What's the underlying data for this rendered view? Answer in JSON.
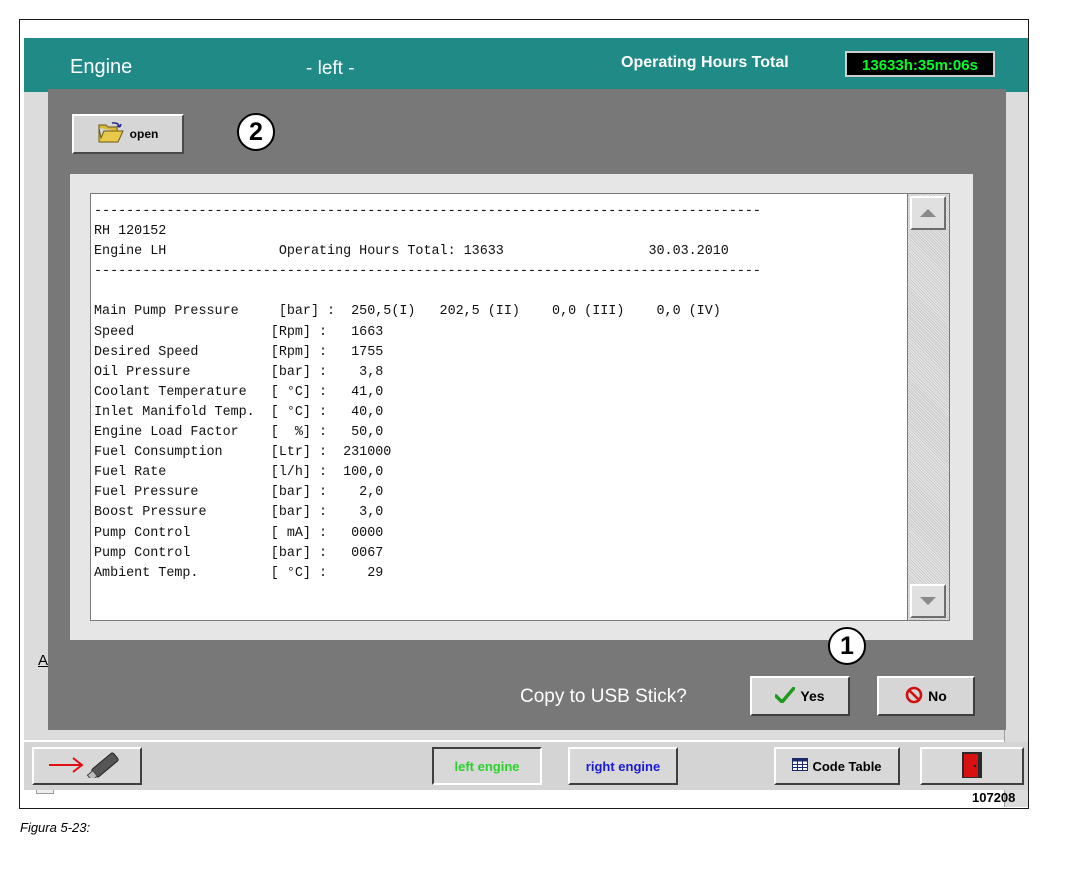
{
  "header": {
    "title": "Engine",
    "side": "- left -",
    "operating_hours_label": "Operating Hours Total",
    "operating_hours_value": "13633h:35m:06s",
    "counter_color": "#00ff2a",
    "bar_color": "#1f8a86"
  },
  "dialog": {
    "open_label": "open",
    "callout_open": "2",
    "callout_yes": "1",
    "report_lines": [
      "-----------------------------------------------------------------------------------",
      "RH 120152",
      "Engine LH              Operating Hours Total: 13633                  30.03.2010",
      "-----------------------------------------------------------------------------------",
      "",
      "Main Pump Pressure     [bar] :  250,5(I)   202,5 (II)    0,0 (III)    0,0 (IV)",
      "Speed                 [Rpm] :   1663",
      "Desired Speed         [Rpm] :   1755",
      "Oil Pressure          [bar] :    3,8",
      "Coolant Temperature   [ °C] :   41,0",
      "Inlet Manifold Temp.  [ °C] :   40,0",
      "Engine Load Factor    [  %] :   50,0",
      "Fuel Consumption      [Ltr] :  231000",
      "Fuel Rate             [l/h] :  100,0",
      "Fuel Pressure         [bar] :    2,0",
      "Boost Pressure        [bar] :    3,0",
      "Pump Control          [ mA] :   0000",
      "Pump Control          [bar] :   0067",
      "Ambient Temp.         [ °C] :     29"
    ],
    "copy_question": "Copy to USB Stick?",
    "yes_label": "Yes",
    "no_label": "No"
  },
  "background": {
    "stub_label": "A"
  },
  "bottom_bar": {
    "left_engine_label": "left engine",
    "right_engine_label": "right engine",
    "code_table_label": "Code Table",
    "left_engine_color": "#2bd22b",
    "right_engine_color": "#1a1ad6"
  },
  "figure_id": "107208",
  "caption": "Figura 5-23:"
}
